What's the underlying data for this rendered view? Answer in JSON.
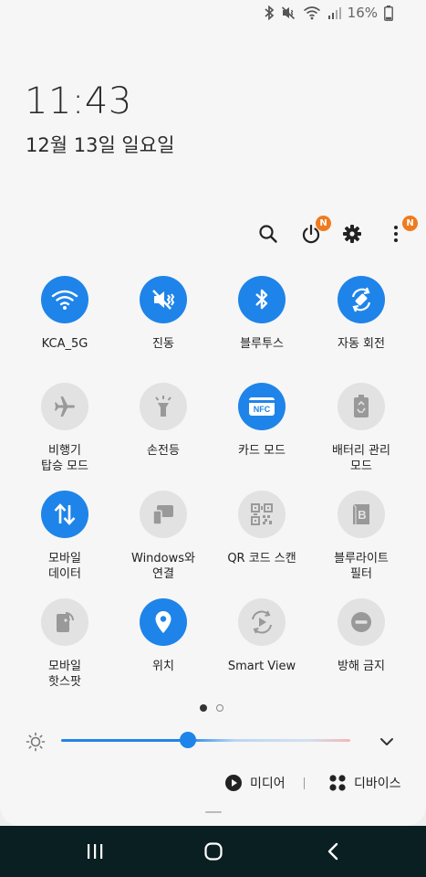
{
  "status": {
    "battery": "16%"
  },
  "clock": {
    "time": "11:43",
    "date": "12월 13일 일요일"
  },
  "badges": {
    "power": "N",
    "more": "N"
  },
  "tiles": [
    {
      "label": "KCA_5G",
      "state": "on",
      "icon": "wifi-icon"
    },
    {
      "label": "진동",
      "state": "on",
      "icon": "vibrate-icon"
    },
    {
      "label": "블루투스",
      "state": "on",
      "icon": "bluetooth-icon"
    },
    {
      "label": "자동 회전",
      "state": "on",
      "icon": "auto-rotate-icon"
    },
    {
      "label": "비행기\n탑승 모드",
      "state": "off",
      "icon": "airplane-icon"
    },
    {
      "label": "손전등",
      "state": "off",
      "icon": "flashlight-icon"
    },
    {
      "label": "카드 모드",
      "state": "on",
      "icon": "nfc-icon",
      "icon_text": "NFC"
    },
    {
      "label": "배터리 관리\n모드",
      "state": "off",
      "icon": "battery-recycle-icon"
    },
    {
      "label": "모바일\n데이터",
      "state": "on",
      "icon": "mobile-data-icon"
    },
    {
      "label": "Windows와\n연결",
      "state": "off",
      "icon": "link-to-windows-icon"
    },
    {
      "label": "QR 코드 스캔",
      "state": "off",
      "icon": "qr-code-icon"
    },
    {
      "label": "블루라이트\n필터",
      "state": "off",
      "icon": "blue-light-filter-icon",
      "icon_text": "B"
    },
    {
      "label": "모바일\n핫스팟",
      "state": "off",
      "icon": "hotspot-icon"
    },
    {
      "label": "위치",
      "state": "on",
      "icon": "location-icon"
    },
    {
      "label": "Smart View",
      "state": "off",
      "icon": "smart-view-icon"
    },
    {
      "label": "방해 금지",
      "state": "off",
      "icon": "do-not-disturb-icon"
    }
  ],
  "pages": {
    "count": 2,
    "current": 1
  },
  "brightness": {
    "level": 0.44
  },
  "bottom": {
    "media_label": "미디어",
    "devices_label": "디바이스"
  },
  "colors": {
    "accent": "#1e84e9",
    "badge": "#f07b1e",
    "navbar": "#0a1f21",
    "tile_off": "#e2e2e2"
  }
}
